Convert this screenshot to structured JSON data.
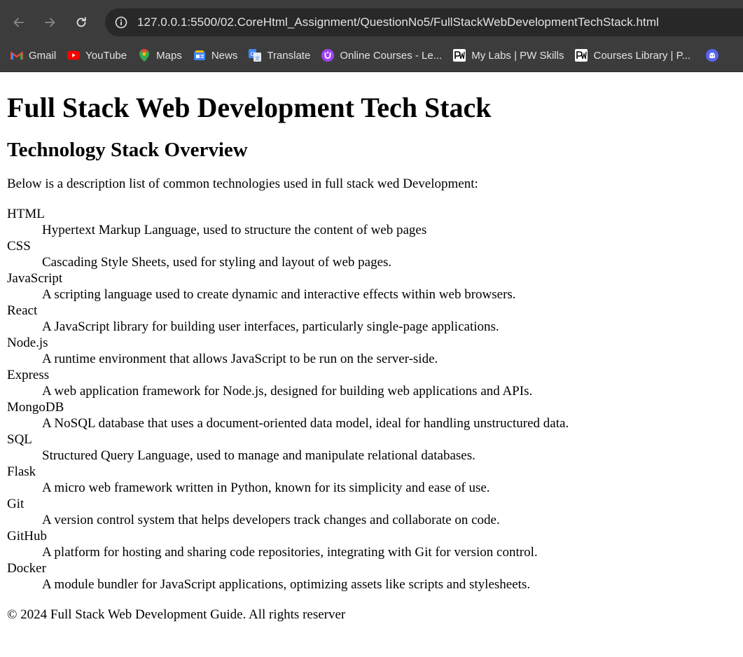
{
  "browser": {
    "url": "127.0.0.1:5500/02.CoreHtml_Assignment/QuestionNo5/FullStackWebDevelopmentTechStack.html",
    "bookmarks": [
      {
        "label": "Gmail",
        "icon": "gmail-icon"
      },
      {
        "label": "YouTube",
        "icon": "youtube-icon"
      },
      {
        "label": "Maps",
        "icon": "maps-icon"
      },
      {
        "label": "News",
        "icon": "news-icon"
      },
      {
        "label": "Translate",
        "icon": "translate-icon"
      },
      {
        "label": "Online Courses - Le...",
        "icon": "courses-icon"
      },
      {
        "label": "My Labs | PW Skills",
        "icon": "pw-skills-icon"
      },
      {
        "label": "Courses Library | P...",
        "icon": "pw-skills-icon"
      }
    ]
  },
  "page": {
    "title": "Full Stack Web Development Tech Stack",
    "subtitle": "Technology Stack Overview",
    "intro": "Below is a description list of common technologies used in full stack wed Development:",
    "terms": [
      {
        "term": "HTML",
        "desc": "Hypertext Markup Language, used to structure the content of web pages"
      },
      {
        "term": "CSS",
        "desc": "Cascading Style Sheets, used for styling and layout of web pages."
      },
      {
        "term": "JavaScript",
        "desc": "A scripting language used to create dynamic and interactive effects within web browsers."
      },
      {
        "term": "React",
        "desc": "A JavaScript library for building user interfaces, particularly single-page applications."
      },
      {
        "term": "Node.js",
        "desc": "A runtime environment that allows JavaScript to be run on the server-side."
      },
      {
        "term": "Express",
        "desc": "A web application framework for Node.js, designed for building web applications and APIs."
      },
      {
        "term": "MongoDB",
        "desc": "A NoSQL database that uses a document-oriented data model, ideal for handling unstructured data."
      },
      {
        "term": "SQL",
        "desc": "Structured Query Language, used to manage and manipulate relational databases."
      },
      {
        "term": "Flask",
        "desc": "A micro web framework written in Python, known for its simplicity and ease of use."
      },
      {
        "term": "Git",
        "desc": "A version control system that helps developers track changes and collaborate on code."
      },
      {
        "term": "GitHub",
        "desc": "A platform for hosting and sharing code repositories, integrating with Git for version control."
      },
      {
        "term": "Docker",
        "desc": "A module bundler for JavaScript applications, optimizing assets like scripts and stylesheets."
      }
    ],
    "footer": "© 2024 Full Stack Web Development Guide. All rights reserver"
  },
  "colors": {
    "chrome_bg": "#3c3c3c",
    "omnibox_bg": "#282828",
    "chrome_text": "#e3e3e3",
    "page_bg": "#ffffff",
    "page_text": "#000000"
  }
}
